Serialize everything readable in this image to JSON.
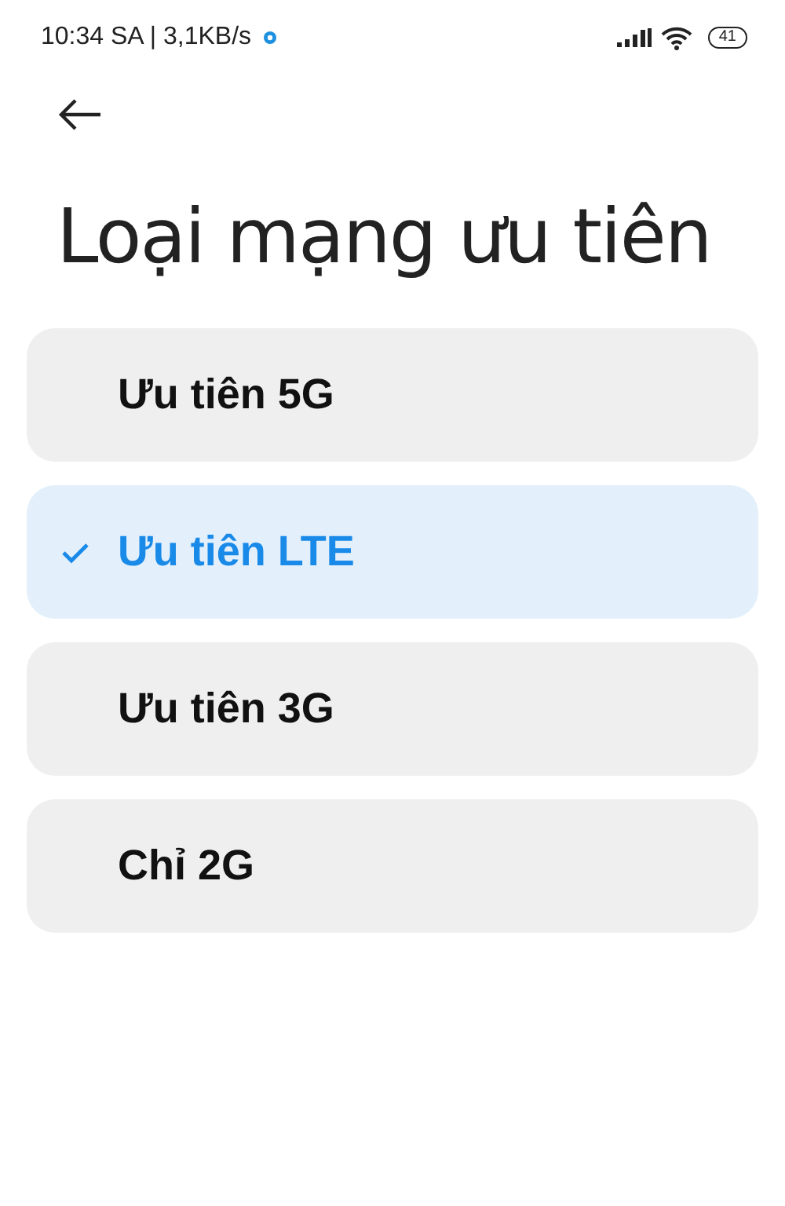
{
  "status_bar": {
    "time": "10:34 SA | 3,1KB/s",
    "battery": "41"
  },
  "title": "Loại mạng ưu tiên",
  "options": [
    {
      "label": "Ưu tiên 5G",
      "selected": false
    },
    {
      "label": "Ưu tiên LTE",
      "selected": true
    },
    {
      "label": "Ưu tiên 3G",
      "selected": false
    },
    {
      "label": "Chỉ 2G",
      "selected": false
    }
  ]
}
